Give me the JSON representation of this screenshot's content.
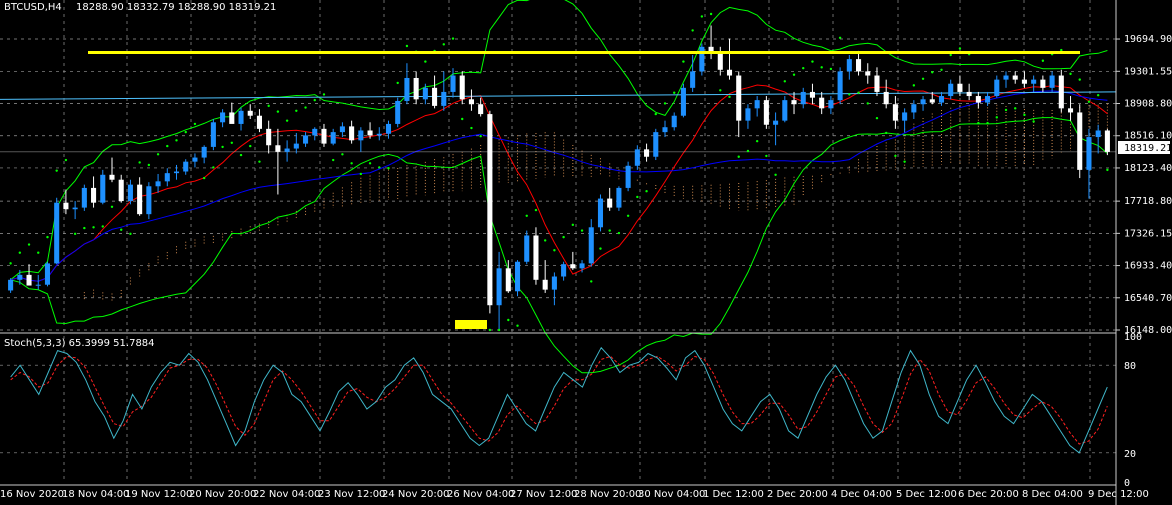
{
  "header": {
    "symbol_label": "BTCUSD,H4",
    "ohlc_label": "18288.90 18332.79 18288.90 18319.21"
  },
  "stoch_header": {
    "label": "Stoch(5,3,3) 65.3999 51.7884"
  },
  "current_price_label": "18319.21",
  "colors": {
    "background": "#000000",
    "grid": "#9a9a9a",
    "bull_candle": "#1e90ff",
    "bear_candle": "#ffffff",
    "resistance": "#ffff00",
    "support_marker": "#ffff00",
    "stoch_main": "#3fb6c9",
    "stoch_signal": "#ff2020",
    "ma_fast": "#ff0000",
    "ma_slow": "#0000ff",
    "bollinger": "#00ff00",
    "psar": "#00ff00",
    "ichimoku_cloud": "#f4a460",
    "horizontal_line": "#4fc3ff"
  },
  "chart_data": [
    {
      "type": "candlestick",
      "title": "BTCUSD,H4",
      "ylim": [
        16148.0,
        20000.0
      ],
      "price_axis_labels": [
        "19694.90",
        "19301.55",
        "18908.80",
        "18516.10",
        "18123.40",
        "17718.80",
        "17326.15",
        "16933.40",
        "16540.70",
        "16148.00"
      ],
      "time_axis_labels": [
        "16 Nov 2020",
        "18 Nov 04:00",
        "19 Nov 12:00",
        "20 Nov 20:00",
        "22 Nov 04:00",
        "23 Nov 12:00",
        "24 Nov 20:00",
        "26 Nov 04:00",
        "27 Nov 12:00",
        "28 Nov 20:00",
        "30 Nov 04:00",
        "1 Dec 12:00",
        "2 Dec 20:00",
        "4 Dec 04:00",
        "5 Dec 12:00",
        "6 Dec 20:00",
        "8 Dec 04:00",
        "9 Dec 12:00"
      ],
      "current_price": 18319.21,
      "resistance_level": 19530,
      "candles": [
        [
          16630,
          16780,
          16600,
          16760
        ],
        [
          16760,
          16880,
          16700,
          16820
        ],
        [
          16820,
          16950,
          16780,
          16690
        ],
        [
          16690,
          16820,
          16640,
          16700
        ],
        [
          16700,
          16980,
          16680,
          16960
        ],
        [
          16960,
          17760,
          16950,
          17700
        ],
        [
          17700,
          17860,
          17560,
          17620
        ],
        [
          17620,
          17720,
          17500,
          17640
        ],
        [
          17640,
          17920,
          17600,
          17880
        ],
        [
          17880,
          18020,
          17640,
          17700
        ],
        [
          17700,
          18100,
          17680,
          18040
        ],
        [
          18040,
          18250,
          17950,
          17980
        ],
        [
          17980,
          18040,
          17700,
          17720
        ],
        [
          17720,
          17980,
          17680,
          17920
        ],
        [
          17920,
          18010,
          17540,
          17560
        ],
        [
          17560,
          17950,
          17500,
          17900
        ],
        [
          17900,
          18050,
          17820,
          17960
        ],
        [
          17960,
          18120,
          17900,
          18060
        ],
        [
          18060,
          18160,
          17980,
          18080
        ],
        [
          18080,
          18230,
          18040,
          18200
        ],
        [
          18200,
          18300,
          18130,
          18250
        ],
        [
          18250,
          18400,
          18180,
          18380
        ],
        [
          18380,
          18720,
          18340,
          18680
        ],
        [
          18680,
          18840,
          18620,
          18800
        ],
        [
          18800,
          18920,
          18700,
          18660
        ],
        [
          18660,
          18860,
          18580,
          18820
        ],
        [
          18820,
          18900,
          18720,
          18760
        ],
        [
          18760,
          18840,
          18560,
          18600
        ],
        [
          18600,
          18700,
          18300,
          18400
        ],
        [
          18400,
          18600,
          17800,
          18320
        ],
        [
          18320,
          18460,
          18200,
          18360
        ],
        [
          18360,
          18550,
          18300,
          18420
        ],
        [
          18420,
          18560,
          18380,
          18520
        ],
        [
          18520,
          18620,
          18460,
          18600
        ],
        [
          18600,
          18660,
          18380,
          18420
        ],
        [
          18420,
          18600,
          18400,
          18560
        ],
        [
          18560,
          18680,
          18500,
          18630
        ],
        [
          18630,
          18700,
          18420,
          18460
        ],
        [
          18460,
          18620,
          18320,
          18580
        ],
        [
          18580,
          18680,
          18480,
          18520
        ],
        [
          18520,
          18620,
          18460,
          18540
        ],
        [
          18540,
          18700,
          18480,
          18660
        ],
        [
          18660,
          18980,
          18620,
          18940
        ],
        [
          18940,
          19400,
          18900,
          19220
        ],
        [
          19220,
          19300,
          18900,
          18960
        ],
        [
          18960,
          19150,
          18900,
          19100
        ],
        [
          19100,
          19250,
          18850,
          18880
        ],
        [
          18880,
          19300,
          18820,
          19050
        ],
        [
          19050,
          19340,
          18980,
          19250
        ],
        [
          19250,
          19300,
          18900,
          18960
        ],
        [
          18960,
          19080,
          18820,
          18900
        ],
        [
          18900,
          18980,
          18750,
          18780
        ],
        [
          18780,
          18820,
          16350,
          16450
        ],
        [
          16450,
          17100,
          16150,
          16900
        ],
        [
          16900,
          17000,
          16600,
          16620
        ],
        [
          16620,
          17000,
          16560,
          16980
        ],
        [
          16980,
          17360,
          16950,
          17300
        ],
        [
          17300,
          17400,
          16700,
          16760
        ],
        [
          16760,
          17000,
          16600,
          16640
        ],
        [
          16640,
          16850,
          16450,
          16800
        ],
        [
          16800,
          16980,
          16750,
          16950
        ],
        [
          16950,
          17100,
          16880,
          16900
        ],
        [
          16900,
          17000,
          16850,
          16960
        ],
        [
          16960,
          17500,
          16920,
          17400
        ],
        [
          17400,
          17800,
          17350,
          17750
        ],
        [
          17750,
          17880,
          17600,
          17640
        ],
        [
          17640,
          17900,
          17600,
          17880
        ],
        [
          17880,
          18200,
          17840,
          18150
        ],
        [
          18150,
          18400,
          18100,
          18350
        ],
        [
          18350,
          18420,
          18200,
          18260
        ],
        [
          18260,
          18600,
          18220,
          18560
        ],
        [
          18560,
          18700,
          18500,
          18620
        ],
        [
          18620,
          18800,
          18580,
          18760
        ],
        [
          18760,
          19150,
          18740,
          19100
        ],
        [
          19100,
          19500,
          19050,
          19300
        ],
        [
          19300,
          19640,
          19250,
          19600
        ],
        [
          19600,
          19860,
          19450,
          19520
        ],
        [
          19520,
          19600,
          19250,
          19320
        ],
        [
          19320,
          19700,
          19200,
          19250
        ],
        [
          19250,
          19300,
          18500,
          18700
        ],
        [
          18700,
          18900,
          18600,
          18850
        ],
        [
          18850,
          19000,
          18750,
          18950
        ],
        [
          18950,
          19000,
          18600,
          18650
        ],
        [
          18650,
          18800,
          18400,
          18700
        ],
        [
          18700,
          19000,
          18680,
          18950
        ],
        [
          18950,
          19050,
          18780,
          18900
        ],
        [
          18900,
          19100,
          18850,
          19050
        ],
        [
          19050,
          19150,
          18900,
          18980
        ],
        [
          18980,
          19050,
          18780,
          18850
        ],
        [
          18850,
          19000,
          18780,
          18950
        ],
        [
          18950,
          19350,
          18900,
          19300
        ],
        [
          19300,
          19500,
          19200,
          19450
        ],
        [
          19450,
          19550,
          19250,
          19300
        ],
        [
          19300,
          19400,
          19150,
          19250
        ],
        [
          19250,
          19350,
          19000,
          19050
        ],
        [
          19050,
          19200,
          18850,
          18900
        ],
        [
          18900,
          19000,
          18600,
          18700
        ],
        [
          18700,
          18850,
          18560,
          18800
        ],
        [
          18800,
          18950,
          18720,
          18900
        ],
        [
          18900,
          19000,
          18820,
          18960
        ],
        [
          18960,
          19050,
          18900,
          18920
        ],
        [
          18920,
          19050,
          18880,
          19000
        ],
        [
          19000,
          19200,
          18960,
          19150
        ],
        [
          19150,
          19250,
          19000,
          19050
        ],
        [
          19050,
          19150,
          18950,
          19000
        ],
        [
          19000,
          19050,
          18850,
          18920
        ],
        [
          18920,
          19050,
          18880,
          19000
        ],
        [
          19000,
          19250,
          18980,
          19200
        ],
        [
          19200,
          19300,
          19100,
          19250
        ],
        [
          19250,
          19300,
          19150,
          19200
        ],
        [
          19200,
          19300,
          19100,
          19150
        ],
        [
          19150,
          19250,
          19050,
          19200
        ],
        [
          19200,
          19250,
          19050,
          19100
        ],
        [
          19100,
          19300,
          19050,
          19250
        ],
        [
          19250,
          19320,
          18800,
          18850
        ],
        [
          18850,
          19000,
          18700,
          18800
        ],
        [
          18800,
          18900,
          18000,
          18100
        ],
        [
          18100,
          18600,
          17750,
          18500
        ],
        [
          18500,
          18650,
          18300,
          18580
        ],
        [
          18580,
          18600,
          18280,
          18319.21
        ]
      ]
    },
    {
      "type": "line",
      "title": "Stoch(5,3,3) 65.3999 51.7884",
      "ylim": [
        0,
        100
      ],
      "level_labels": [
        "100",
        "80",
        "20",
        "0"
      ],
      "series": [
        {
          "name": "main",
          "values": [
            72,
            80,
            70,
            60,
            75,
            90,
            88,
            82,
            70,
            55,
            45,
            30,
            42,
            60,
            50,
            65,
            75,
            82,
            80,
            88,
            82,
            70,
            55,
            40,
            25,
            35,
            55,
            70,
            80,
            75,
            60,
            55,
            45,
            35,
            48,
            62,
            68,
            60,
            50,
            55,
            65,
            70,
            80,
            85,
            75,
            60,
            55,
            50,
            40,
            30,
            25,
            30,
            45,
            60,
            50,
            40,
            35,
            50,
            65,
            75,
            70,
            65,
            80,
            92,
            85,
            75,
            80,
            82,
            88,
            85,
            78,
            70,
            85,
            90,
            80,
            65,
            50,
            40,
            35,
            45,
            55,
            60,
            50,
            35,
            30,
            45,
            60,
            72,
            80,
            70,
            55,
            40,
            30,
            35,
            55,
            75,
            90,
            80,
            60,
            45,
            40,
            55,
            70,
            80,
            68,
            55,
            45,
            40,
            50,
            60,
            55,
            45,
            35,
            25,
            20,
            35,
            50,
            65
          ]
        },
        {
          "name": "signal",
          "values": [
            70,
            75,
            72,
            65,
            68,
            80,
            86,
            85,
            78,
            65,
            52,
            40,
            38,
            48,
            52,
            58,
            68,
            78,
            80,
            84,
            84,
            78,
            66,
            52,
            38,
            32,
            40,
            55,
            70,
            76,
            70,
            62,
            52,
            42,
            42,
            52,
            62,
            64,
            58,
            55,
            58,
            64,
            72,
            80,
            80,
            70,
            60,
            54,
            46,
            38,
            30,
            28,
            34,
            46,
            52,
            46,
            40,
            42,
            52,
            64,
            70,
            70,
            74,
            84,
            86,
            80,
            78,
            80,
            84,
            86,
            82,
            76,
            80,
            86,
            84,
            74,
            60,
            48,
            40,
            40,
            46,
            54,
            54,
            46,
            36,
            38,
            48,
            60,
            72,
            74,
            66,
            52,
            40,
            34,
            40,
            56,
            74,
            84,
            76,
            60,
            48,
            46,
            56,
            68,
            72,
            64,
            54,
            46,
            44,
            50,
            55,
            52,
            44,
            34,
            26,
            28,
            36,
            52
          ]
        }
      ]
    }
  ]
}
